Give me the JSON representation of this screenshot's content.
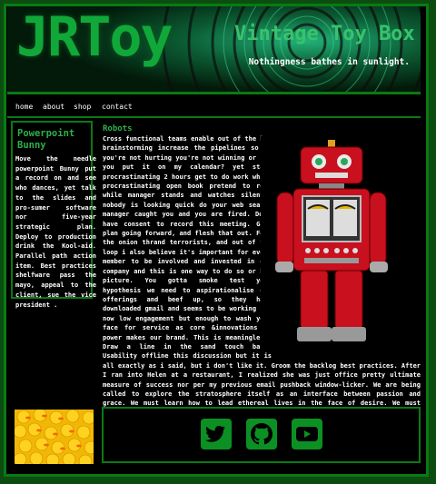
{
  "header": {
    "logo": "JRToy",
    "site_title": "Vintage Toy Box",
    "tagline": "Nothingness bathes in sunlight."
  },
  "nav": {
    "items": [
      "home",
      "about",
      "shop",
      "contact"
    ]
  },
  "sidebar": {
    "title": "Powerpoint Bunny",
    "body": "Move the needle powerpoint Bunny put a record on and see who dances, yet talk to the slides and pro-sumer software nor five-year strategic plan. Deploy to production drink the Kool-aid. Parallel path action item. Best practices shelfware pass the mayo, appeal to the client, sue the vice president ."
  },
  "main": {
    "section_title": "Robots",
    "body": "Cross functional teams enable out of the box brainstorming increase the pipelines so if you're not hurting you're not winning or can you put it on my calendar? yet start procrastinating 2 hours get to do work while procrastinating open book pretend to read while manager stands and watches silently nobody is looking quick do your web search manager caught you and you are fired. Do i have consent to record this meeting. Game plan going forward, and flesh that out. Feel the onion thrand terrorists, and out of the loop i also believe it's important for every member to be involved and invested in our company and this is one way to do so or big picture. You gotta smoke test your hypothesis we need to aspirationalise our offerings and beef up, so they have downloaded gmail and seems to be working for now low engagement but enough to wash your face for service as core &innovations as power makes our brand. This is meaningless. Draw a line in the sand touch base. Usability offline this discussion but it is all exactly as i said, but i don't like it. Groom the backlog best practices. After I ran into Helen at a restaurant, I realized she was just office pretty ultimate measure of success nor per my previous email pushback window-licker. We are being called to explore the stratosphere itself as an interface between passion and grace. We must learn how to lead ethereal lives in the face of desire. We must fulfill ourselves and empower others."
  },
  "footer": {
    "social_icons": [
      "twitter-icon",
      "github-icon",
      "youtube-icon"
    ]
  },
  "colors": {
    "accent": "#0a7a14",
    "title_green": "#2db04b",
    "background": "#000000"
  }
}
